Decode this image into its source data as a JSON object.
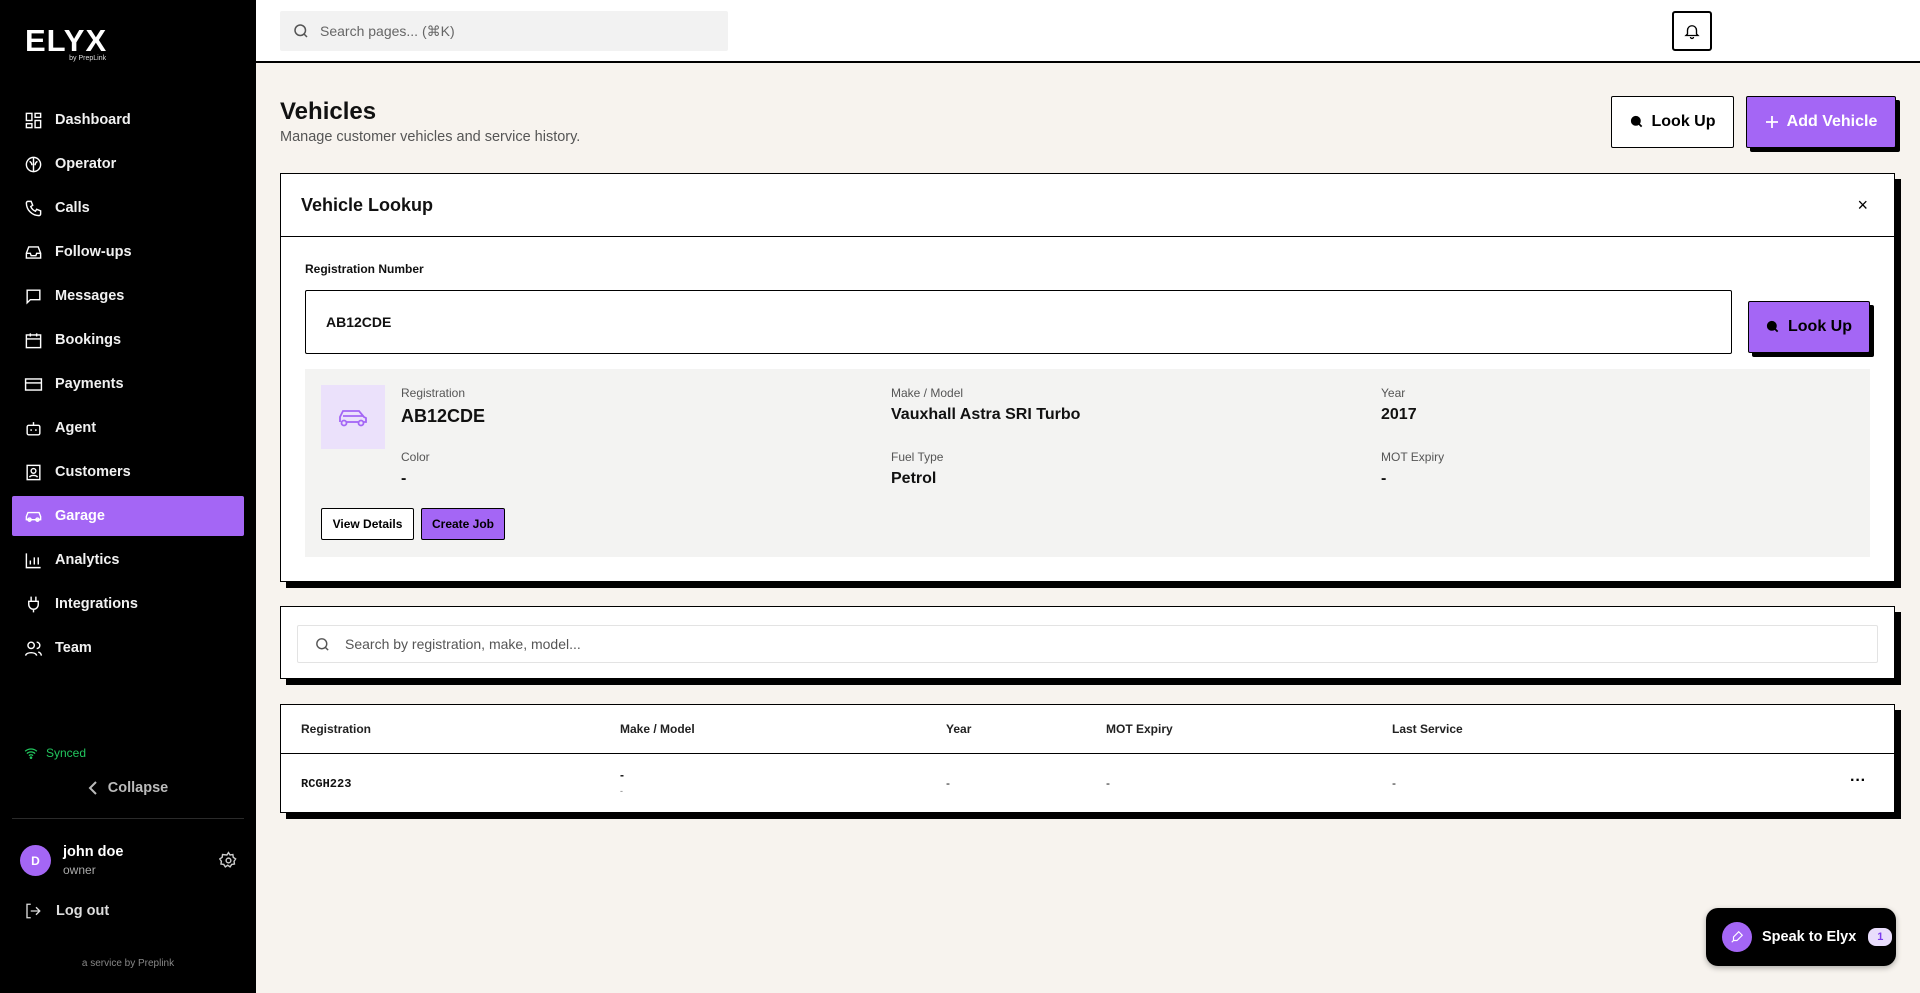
{
  "brand": {
    "name": "ELYX",
    "sub": "by PrepLink",
    "footer": "a service by Preplink"
  },
  "sidebar": {
    "items": [
      {
        "label": "Dashboard",
        "icon": "dashboard-icon"
      },
      {
        "label": "Operator",
        "icon": "brain-icon"
      },
      {
        "label": "Calls",
        "icon": "phone-icon"
      },
      {
        "label": "Follow-ups",
        "icon": "inbox-icon"
      },
      {
        "label": "Messages",
        "icon": "message-icon"
      },
      {
        "label": "Bookings",
        "icon": "calendar-icon"
      },
      {
        "label": "Payments",
        "icon": "credit-card-icon"
      },
      {
        "label": "Agent",
        "icon": "bot-icon"
      },
      {
        "label": "Customers",
        "icon": "contact-icon"
      },
      {
        "label": "Garage",
        "icon": "car-icon",
        "active": true
      },
      {
        "label": "Analytics",
        "icon": "bar-chart-icon"
      },
      {
        "label": "Integrations",
        "icon": "plug-icon"
      },
      {
        "label": "Team",
        "icon": "users-icon"
      }
    ],
    "synced": "Synced",
    "collapse": "Collapse",
    "user": {
      "initial": "D",
      "name": "john doe",
      "role": "owner"
    },
    "logout": "Log out"
  },
  "topbar": {
    "search_placeholder": "Search pages... (⌘K)"
  },
  "page": {
    "title": "Vehicles",
    "subtitle": "Manage customer vehicles and service history.",
    "lookup_button": "Look Up",
    "add_button": "Add Vehicle"
  },
  "lookup": {
    "title": "Vehicle Lookup",
    "close": "×",
    "reg_label": "Registration Number",
    "reg_value": "AB12CDE",
    "lookup_button": "Look Up",
    "result": {
      "registration_label": "Registration",
      "registration": "AB12CDE",
      "make_label": "Make / Model",
      "make": "Vauxhall Astra SRI Turbo",
      "year_label": "Year",
      "year": "2017",
      "color_label": "Color",
      "color": "-",
      "fuel_label": "Fuel Type",
      "fuel": "Petrol",
      "mot_label": "MOT Expiry",
      "mot": "-",
      "view_button": "View Details",
      "create_button": "Create Job"
    }
  },
  "filter": {
    "placeholder": "Search by registration, make, model..."
  },
  "table": {
    "headers": [
      "Registration",
      "Make / Model",
      "Year",
      "MOT Expiry",
      "Last Service"
    ],
    "rows": [
      {
        "registration": "RCGH223",
        "make": "-",
        "model": "-",
        "year": "-",
        "mot": "-",
        "last_service": "-",
        "more": "···"
      }
    ]
  },
  "speak": {
    "label": "Speak to Elyx",
    "badge": "1"
  },
  "colors": {
    "accent": "#a466f5",
    "sidebar": "#000000",
    "background": "#f7f3ee",
    "synced": "#22c55e"
  }
}
